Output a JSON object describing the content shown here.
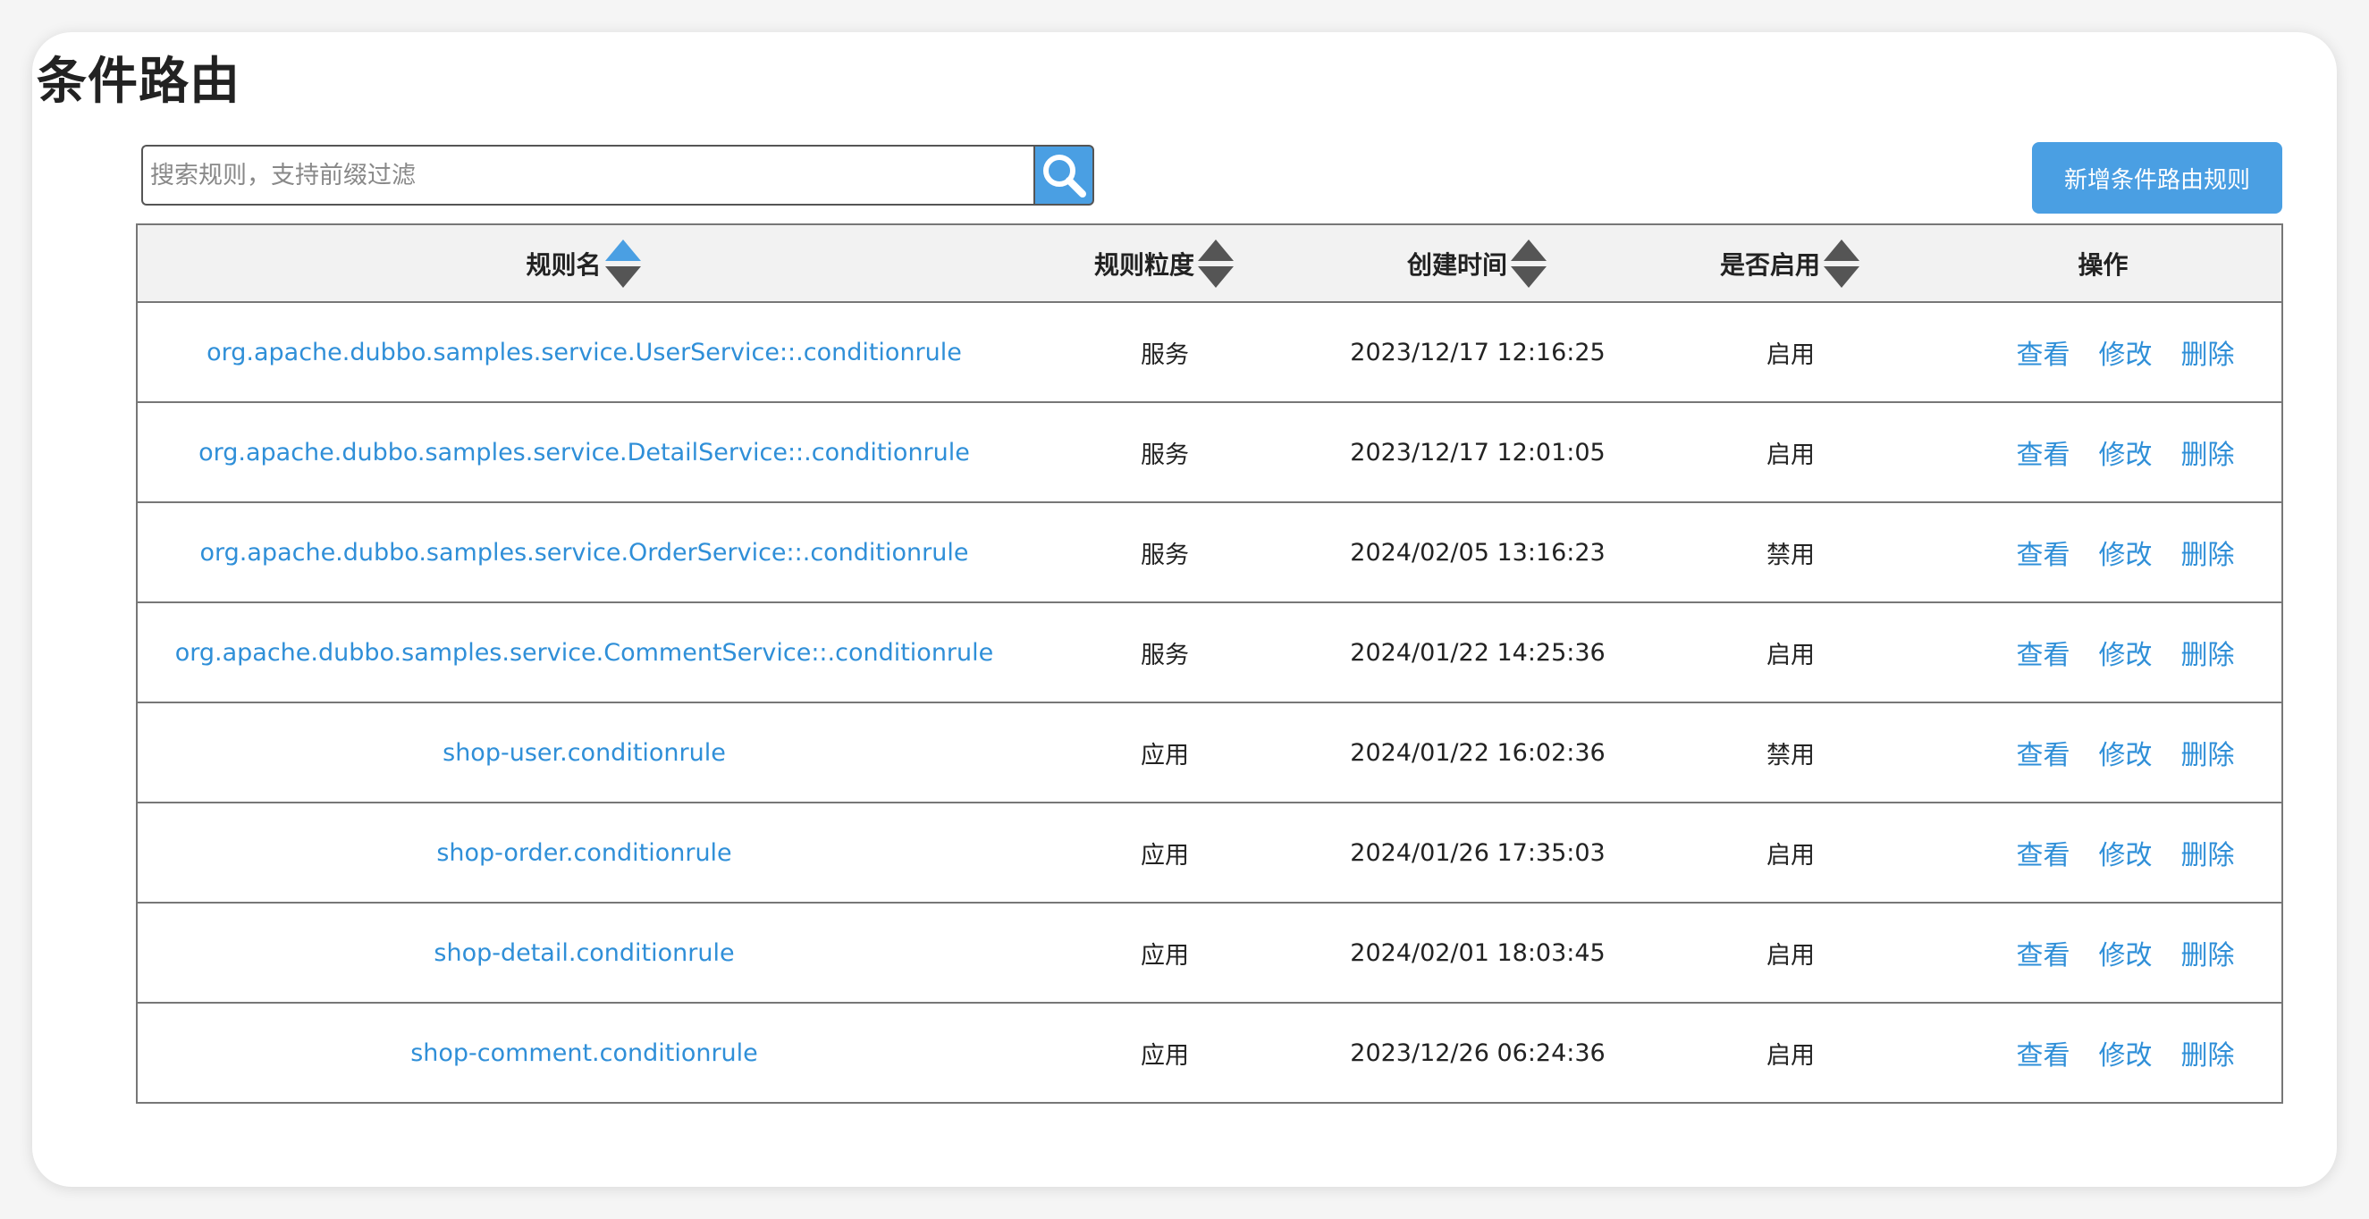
{
  "page": {
    "title": "条件路由"
  },
  "search": {
    "placeholder": "搜索规则，支持前缀过滤",
    "value": "",
    "icon": "search-icon"
  },
  "toolbar": {
    "add_label": "新增条件路由规则"
  },
  "table": {
    "columns": [
      {
        "label": "规则名",
        "sortable": true,
        "sort_state": "ascending"
      },
      {
        "label": "规则粒度",
        "sortable": true,
        "sort_state": "none"
      },
      {
        "label": "创建时间",
        "sortable": true,
        "sort_state": "none"
      },
      {
        "label": "是否启用",
        "sortable": true,
        "sort_state": "none"
      },
      {
        "label": "操作",
        "sortable": false
      }
    ],
    "rows": [
      {
        "name": "org.apache.dubbo.samples.service.UserService::.conditionrule",
        "scope": "服务",
        "created": "2023/12/17 12:16:25",
        "enabled": "启用",
        "view": "查看",
        "edit": "修改",
        "delete": "删除"
      },
      {
        "name": "org.apache.dubbo.samples.service.DetailService::.conditionrule",
        "scope": "服务",
        "created": "2023/12/17 12:01:05",
        "enabled": "启用",
        "view": "查看",
        "edit": "修改",
        "delete": "删除"
      },
      {
        "name": "org.apache.dubbo.samples.service.OrderService::.conditionrule",
        "scope": "服务",
        "created": "2024/02/05 13:16:23",
        "enabled": "禁用",
        "view": "查看",
        "edit": "修改",
        "delete": "删除"
      },
      {
        "name": "org.apache.dubbo.samples.service.CommentService::.conditionrule",
        "scope": "服务",
        "created": "2024/01/22 14:25:36",
        "enabled": "启用",
        "view": "查看",
        "edit": "修改",
        "delete": "删除"
      },
      {
        "name": "shop-user.conditionrule",
        "scope": "应用",
        "created": "2024/01/22 16:02:36",
        "enabled": "禁用",
        "view": "查看",
        "edit": "修改",
        "delete": "删除"
      },
      {
        "name": "shop-order.conditionrule",
        "scope": "应用",
        "created": "2024/01/26 17:35:03",
        "enabled": "启用",
        "view": "查看",
        "edit": "修改",
        "delete": "删除"
      },
      {
        "name": "shop-detail.conditionrule",
        "scope": "应用",
        "created": "2024/02/01 18:03:45",
        "enabled": "启用",
        "view": "查看",
        "edit": "修改",
        "delete": "删除"
      },
      {
        "name": "shop-comment.conditionrule",
        "scope": "应用",
        "created": "2023/12/26 06:24:36",
        "enabled": "启用",
        "view": "查看",
        "edit": "修改",
        "delete": "删除"
      }
    ]
  },
  "colors": {
    "accent": "#4a9fe3",
    "link": "#2f8fd8",
    "sort_active": "#4a9fe3",
    "sort_inactive": "#555555",
    "header_bg": "#f2f2f2"
  }
}
